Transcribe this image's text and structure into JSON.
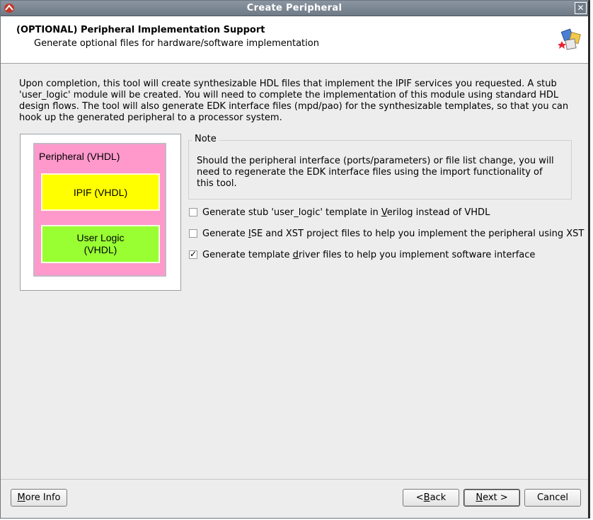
{
  "window": {
    "title": "Create Peripheral",
    "close_glyph": "✕"
  },
  "header": {
    "title": "(OPTIONAL) Peripheral Implementation Support",
    "subtitle": "Generate optional files for hardware/software implementation",
    "icon": "wizard-puzzle-icon"
  },
  "description": "Upon completion, this tool will create synthesizable HDL files that implement the IPIF services you requested. A stub 'user_logic' module will be created. You will need to complete the implementation of this module using standard HDL design flows. The tool will also generate EDK interface files (mpd/pao) for the synthesizable templates, so that you can hook up the generated peripheral to a processor system.",
  "diagram": {
    "peripheral_label": "Peripheral (VHDL)",
    "ipif_label": "IPIF (VHDL)",
    "user_logic_label": "User Logic\n(VHDL)",
    "colors": {
      "peripheral": "#ff99cc",
      "ipif": "#ffff00",
      "user_logic": "#99ff33"
    }
  },
  "note": {
    "legend": "Note",
    "text": "Should the peripheral interface (ports/parameters) or file list change, you will need to regenerate the EDK interface files using the import functionality of this tool."
  },
  "options": [
    {
      "pre": "Generate stub 'user_logic' template in ",
      "mnemonic": "V",
      "post": "erilog instead of VHDL",
      "checked": false
    },
    {
      "pre": "Generate ",
      "mnemonic": "I",
      "post": "SE and XST project files to help you implement the peripheral using XST",
      "checked": false
    },
    {
      "pre": "Generate template ",
      "mnemonic": "d",
      "post": "river files to help you implement software interface",
      "checked": true
    }
  ],
  "buttons": {
    "more_info": {
      "mnemonic": "M",
      "rest": "ore Info"
    },
    "back": {
      "pre": "< ",
      "mnemonic": "B",
      "rest": "ack"
    },
    "next": {
      "mnemonic": "N",
      "rest": "ext >"
    },
    "cancel": {
      "label": "Cancel"
    }
  }
}
